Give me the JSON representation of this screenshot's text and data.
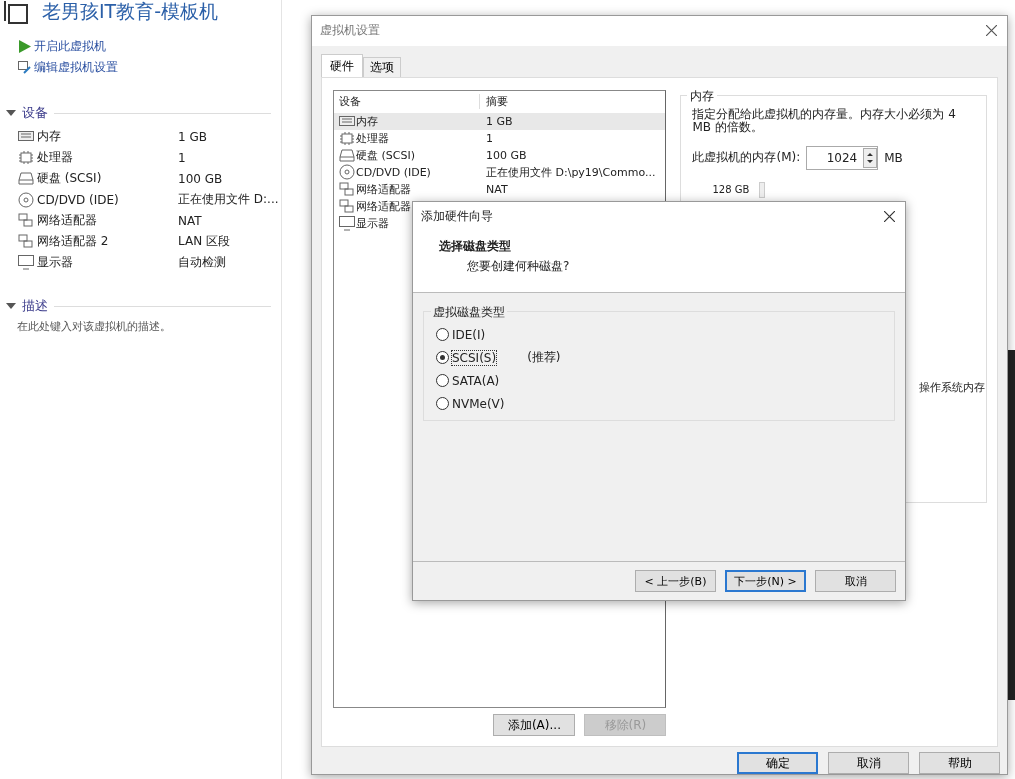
{
  "vm": {
    "title": "老男孩IT教育-模板机",
    "actions": [
      {
        "kind": "start",
        "label": "开启此虚拟机"
      },
      {
        "kind": "edit",
        "label": "编辑虚拟机设置"
      }
    ],
    "devices": {
      "title": "设备",
      "expanded": true,
      "rows": [
        {
          "kind": "memory",
          "name": "内存",
          "summary": "1 GB"
        },
        {
          "kind": "cpu",
          "name": "处理器",
          "summary": "1"
        },
        {
          "kind": "disk",
          "name": "硬盘 (SCSI)",
          "summary": "100 GB"
        },
        {
          "kind": "cd",
          "name": "CD/DVD (IDE)",
          "summary": "正在使用文件 D:..."
        },
        {
          "kind": "network",
          "name": "网络适配器",
          "summary": "NAT"
        },
        {
          "kind": "network",
          "name": "网络适配器 2",
          "summary": "LAN 区段"
        },
        {
          "kind": "display",
          "name": "显示器",
          "summary": "自动检测"
        }
      ]
    },
    "description": {
      "title": "描述",
      "expanded": true,
      "hint": "在此处键入对该虚拟机的描述。"
    }
  },
  "settings": {
    "title": "虚拟机设置",
    "tabs": [
      {
        "label": "硬件",
        "selected": true
      },
      {
        "label": "选项",
        "selected": false
      }
    ],
    "device_table": {
      "columns": [
        "设备",
        "摘要"
      ],
      "rows": [
        {
          "kind": "memory",
          "name": "内存",
          "summary": "1 GB",
          "selected": true
        },
        {
          "kind": "cpu",
          "name": "处理器",
          "summary": "1",
          "selected": false
        },
        {
          "kind": "disk",
          "name": "硬盘 (SCSI)",
          "summary": "100 GB",
          "selected": false
        },
        {
          "kind": "cd",
          "name": "CD/DVD (IDE)",
          "summary": "正在使用文件 D:\\py19\\Commo...",
          "selected": false
        },
        {
          "kind": "network",
          "name": "网络适配器",
          "summary": "NAT",
          "selected": false
        },
        {
          "kind": "network",
          "name": "网络适配器",
          "selected": false
        },
        {
          "kind": "display",
          "name": "显示器",
          "selected": false
        }
      ]
    },
    "memory": {
      "title": "内存",
      "description": "指定分配给此虚拟机的内存量。内存大小必须为 4 MB 的倍数。",
      "field_label": "此虚拟机的内存(M):",
      "value": "1024",
      "unit": "MB",
      "scale_label": "128 GB",
      "note": "操作系统内存"
    },
    "list_buttons": [
      {
        "label": "添加(A)...",
        "disabled": false
      },
      {
        "label": "移除(R)",
        "disabled": true
      }
    ],
    "buttons": [
      {
        "label": "确定",
        "default": true
      },
      {
        "label": "取消",
        "default": false
      },
      {
        "label": "帮助",
        "default": false
      }
    ]
  },
  "wizard": {
    "title": "添加硬件向导",
    "heading": "选择磁盘类型",
    "subheading": "您要创建何种磁盘?",
    "group_title": "虚拟磁盘类型",
    "options": [
      {
        "label": "IDE(I)",
        "selected": false
      },
      {
        "label": "SCSI(S)",
        "selected": true,
        "note": "(推荐)"
      },
      {
        "label": "SATA(A)",
        "selected": false
      },
      {
        "label": "NVMe(V)",
        "selected": false
      }
    ],
    "buttons": [
      {
        "label": "< 上一步(B)",
        "default": false
      },
      {
        "label": "下一步(N) >",
        "default": true
      },
      {
        "label": "取消",
        "default": false
      }
    ]
  }
}
